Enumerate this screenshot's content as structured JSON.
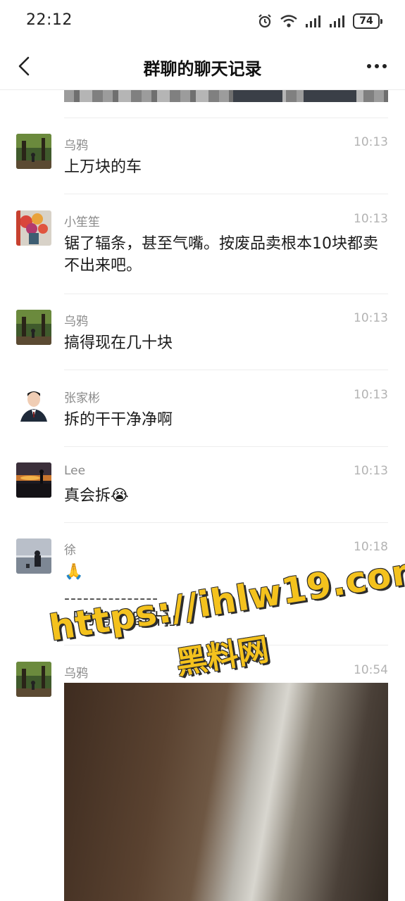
{
  "status_bar": {
    "time": "22:12",
    "battery": "74",
    "icons": [
      "alarm-icon",
      "wifi-icon",
      "signal-icon",
      "signal-icon",
      "battery-icon"
    ]
  },
  "header": {
    "title": "群聊的聊天记录",
    "back_icon": "back-chevron-icon",
    "more_icon": "more-dots-icon"
  },
  "messages": [
    {
      "sender": "乌鸦",
      "time": "10:13",
      "text": "上万块的车",
      "avatar": "forest-photo"
    },
    {
      "sender": "小笙笙",
      "time": "10:13",
      "text": "锯了辐条，甚至气嘴。按废品卖根本10块都卖不出来吧。",
      "avatar": "flowers-photo"
    },
    {
      "sender": "乌鸦",
      "time": "10:13",
      "text": "搞得现在几十块",
      "avatar": "forest-photo"
    },
    {
      "sender": "张家彬",
      "time": "10:13",
      "text": "拆的干干净净啊",
      "avatar": "portrait-photo"
    },
    {
      "sender": "Lee",
      "time": "10:13",
      "text": "真会拆😭",
      "avatar": "sunset-photo"
    },
    {
      "sender": "徐",
      "time": "10:18",
      "text": "🙏",
      "quote_separator": "---------------",
      "quote": "「乌鸦：[图片]」",
      "avatar": "seaside-photo"
    },
    {
      "sender": "乌鸦",
      "time": "10:54",
      "text": "",
      "avatar": "forest-photo",
      "has_image": true
    }
  ],
  "watermark": {
    "line1": "https://ihlw19.com",
    "line2": "黑料网"
  },
  "colors": {
    "watermark": "#f4c21d",
    "sender": "#8a8a8a",
    "time": "#b3b3b3",
    "text": "#1b1b1b"
  }
}
